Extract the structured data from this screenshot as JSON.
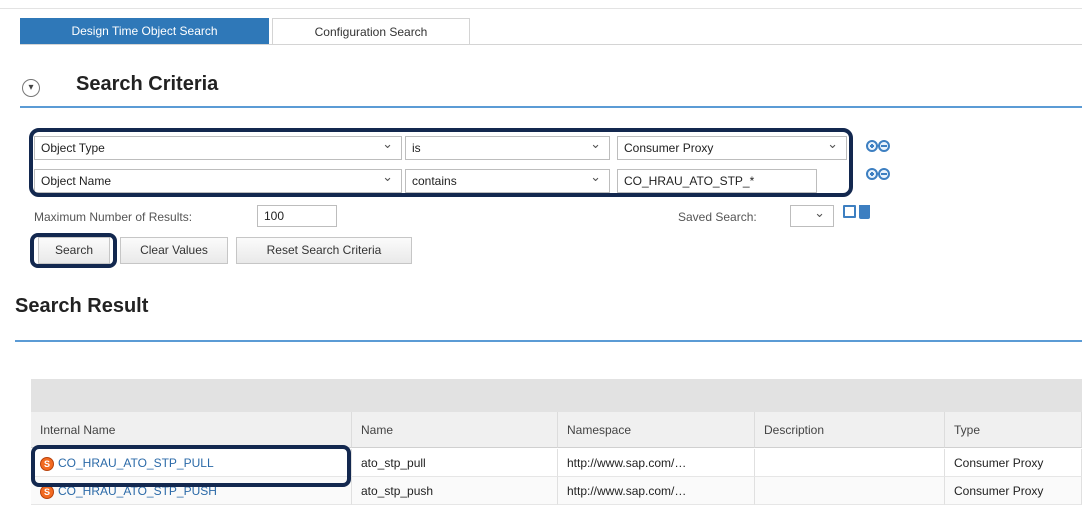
{
  "tabs": [
    {
      "label": "Design Time Object Search",
      "active": true
    },
    {
      "label": "Configuration Search",
      "active": false
    }
  ],
  "criteria": {
    "title": "Search Criteria",
    "rows": [
      {
        "field": "Object Type",
        "operator": "is",
        "value": "Consumer Proxy"
      },
      {
        "field": "Object Name",
        "operator": "contains",
        "value": "CO_HRAU_ATO_STP_*"
      }
    ],
    "max_results_label": "Maximum Number of Results:",
    "max_results_value": "100",
    "saved_search_label": "Saved Search:",
    "saved_search_value": ""
  },
  "buttons": {
    "search": "Search",
    "clear": "Clear Values",
    "reset": "Reset Search Criteria"
  },
  "results": {
    "title": "Search Result",
    "columns": [
      "Internal Name",
      "Name",
      "Namespace",
      "Description",
      "Type"
    ],
    "rows": [
      {
        "internal_name": "CO_HRAU_ATO_STP_PULL",
        "name": "ato_stp_pull",
        "namespace": "http://www.sap.com/…",
        "description": "",
        "type": "Consumer Proxy"
      },
      {
        "internal_name": "CO_HRAU_ATO_STP_PUSH",
        "name": "ato_stp_push",
        "namespace": "http://www.sap.com/…",
        "description": "",
        "type": "Consumer Proxy"
      }
    ]
  },
  "icons": {
    "object": "service-object-icon",
    "add": "add-circle-icon",
    "remove": "remove-circle-icon",
    "save": "save-icon",
    "delete": "trash-icon",
    "collapse": "collapse-icon"
  },
  "colors": {
    "tab_active": "#2f78b8",
    "section_line": "#5b9bd5",
    "highlight_border": "#13284f",
    "link": "#2b6aa8"
  }
}
